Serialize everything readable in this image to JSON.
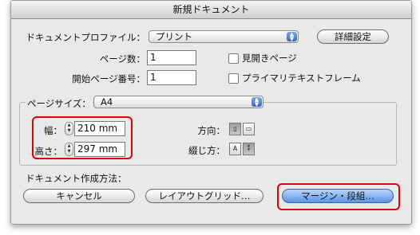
{
  "window": {
    "title": "新規ドキュメント"
  },
  "profile": {
    "label": "ドキュメントプロファイル：",
    "value": "プリント",
    "advanced_button": "詳細設定"
  },
  "pages": {
    "count_label": "ページ数：",
    "count_value": "1",
    "start_label": "開始ページ番号：",
    "start_value": "1"
  },
  "options": {
    "facing_pages": "見開きページ",
    "primary_text_frame": "プライマリテキストフレーム"
  },
  "page_size": {
    "label": "ページサイズ：",
    "value": "A4",
    "width_label": "幅：",
    "width_value": "210 mm",
    "height_label": "高さ：",
    "height_value": "297 mm",
    "orientation_label": "方向：",
    "binding_label": "綴じ方："
  },
  "create": {
    "label": "ドキュメント作成方法：",
    "cancel_button": "キャンセル",
    "layout_grid_button": "レイアウトグリッド…",
    "margins_columns_button": "マージン・段組…"
  },
  "icons": {
    "dropdown": "up-down-arrows-icon",
    "stepper": "stepper-icon",
    "portrait": "portrait-icon",
    "landscape": "landscape-icon",
    "ltr": "left-to-right-binding-icon",
    "rtl": "right-to-left-binding-icon"
  },
  "highlight_color": "#e00000"
}
